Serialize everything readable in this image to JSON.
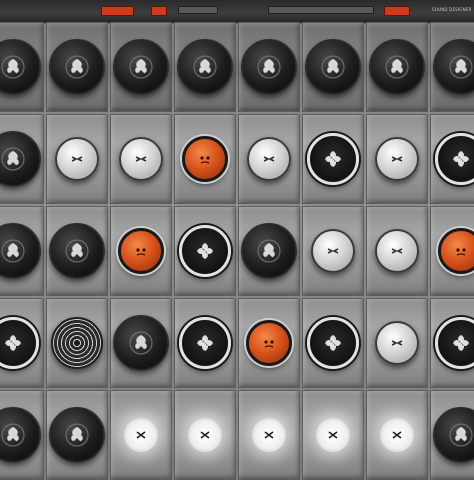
{
  "header": {
    "brand_text": "SOUND DESIGNER",
    "indicators": [
      "red-indicator",
      "red-indicator",
      "red-indicator"
    ]
  },
  "grid": {
    "rows": [
      [
        "black-knob",
        "black-knob",
        "black-knob",
        "black-knob",
        "black-knob",
        "black-knob",
        "black-knob",
        "black-knob"
      ],
      [
        "black-knob",
        "silver-knob",
        "silver-knob",
        "orange-knob",
        "silver-knob",
        "ringed-knob",
        "silver-knob",
        "ringed-knob"
      ],
      [
        "black-knob",
        "black-knob",
        "orange-knob",
        "ringed-knob",
        "black-knob",
        "silver-knob",
        "silver-knob",
        "orange-knob"
      ],
      [
        "ringed-knob",
        "spiral-knob",
        "black-knob",
        "ringed-knob",
        "orange-knob",
        "ringed-knob",
        "silver-knob",
        "ringed-knob"
      ],
      [
        "black-knob",
        "black-knob",
        "white-knob",
        "white-knob",
        "white-knob",
        "white-knob",
        "white-knob",
        "black-knob"
      ]
    ]
  },
  "colors": {
    "accent_orange": "#d9541c",
    "indicator_red": "#d03a1c",
    "panel_gray": "#969696",
    "knob_black": "#111111"
  }
}
